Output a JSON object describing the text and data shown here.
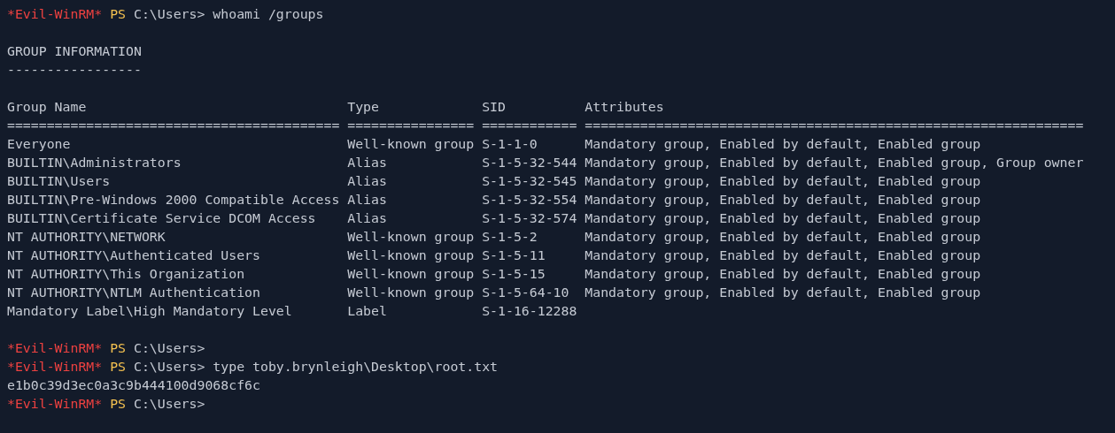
{
  "lines": [
    {
      "kind": "prompt",
      "session": "*Evil-WinRM*",
      "shell": "PS",
      "path": "C:\\Users>",
      "command": "whoami /groups"
    },
    {
      "kind": "blank"
    },
    {
      "kind": "output",
      "text": "GROUP INFORMATION"
    },
    {
      "kind": "output",
      "text": "-----------------"
    },
    {
      "kind": "blank"
    },
    {
      "kind": "table",
      "columns": [
        {
          "heading": "Group Name",
          "rule": "=========================================="
        },
        {
          "heading": "Type",
          "rule": "================"
        },
        {
          "heading": "SID",
          "rule": "============"
        },
        {
          "heading": "Attributes",
          "rule": "==============================================================="
        }
      ],
      "rows": [
        [
          "Everyone",
          "Well-known group",
          "S-1-1-0",
          "Mandatory group, Enabled by default, Enabled group"
        ],
        [
          "BUILTIN\\Administrators",
          "Alias",
          "S-1-5-32-544",
          "Mandatory group, Enabled by default, Enabled group, Group owner"
        ],
        [
          "BUILTIN\\Users",
          "Alias",
          "S-1-5-32-545",
          "Mandatory group, Enabled by default, Enabled group"
        ],
        [
          "BUILTIN\\Pre-Windows 2000 Compatible Access",
          "Alias",
          "S-1-5-32-554",
          "Mandatory group, Enabled by default, Enabled group"
        ],
        [
          "BUILTIN\\Certificate Service DCOM Access",
          "Alias",
          "S-1-5-32-574",
          "Mandatory group, Enabled by default, Enabled group"
        ],
        [
          "NT AUTHORITY\\NETWORK",
          "Well-known group",
          "S-1-5-2",
          "Mandatory group, Enabled by default, Enabled group"
        ],
        [
          "NT AUTHORITY\\Authenticated Users",
          "Well-known group",
          "S-1-5-11",
          "Mandatory group, Enabled by default, Enabled group"
        ],
        [
          "NT AUTHORITY\\This Organization",
          "Well-known group",
          "S-1-5-15",
          "Mandatory group, Enabled by default, Enabled group"
        ],
        [
          "NT AUTHORITY\\NTLM Authentication",
          "Well-known group",
          "S-1-5-64-10",
          "Mandatory group, Enabled by default, Enabled group"
        ],
        [
          "Mandatory Label\\High Mandatory Level",
          "Label",
          "S-1-16-12288",
          ""
        ]
      ]
    },
    {
      "kind": "blank"
    },
    {
      "kind": "prompt",
      "session": "*Evil-WinRM*",
      "shell": "PS",
      "path": "C:\\Users>"
    },
    {
      "kind": "prompt",
      "session": "*Evil-WinRM*",
      "shell": "PS",
      "path": "C:\\Users>",
      "command": "type toby.brynleigh\\Desktop\\root.txt"
    },
    {
      "kind": "output",
      "text": "e1b0c39d3ec0a3c9b444100d9068cf6c"
    },
    {
      "kind": "prompt",
      "session": "*Evil-WinRM*",
      "shell": "PS",
      "path": "C:\\Users>"
    }
  ]
}
